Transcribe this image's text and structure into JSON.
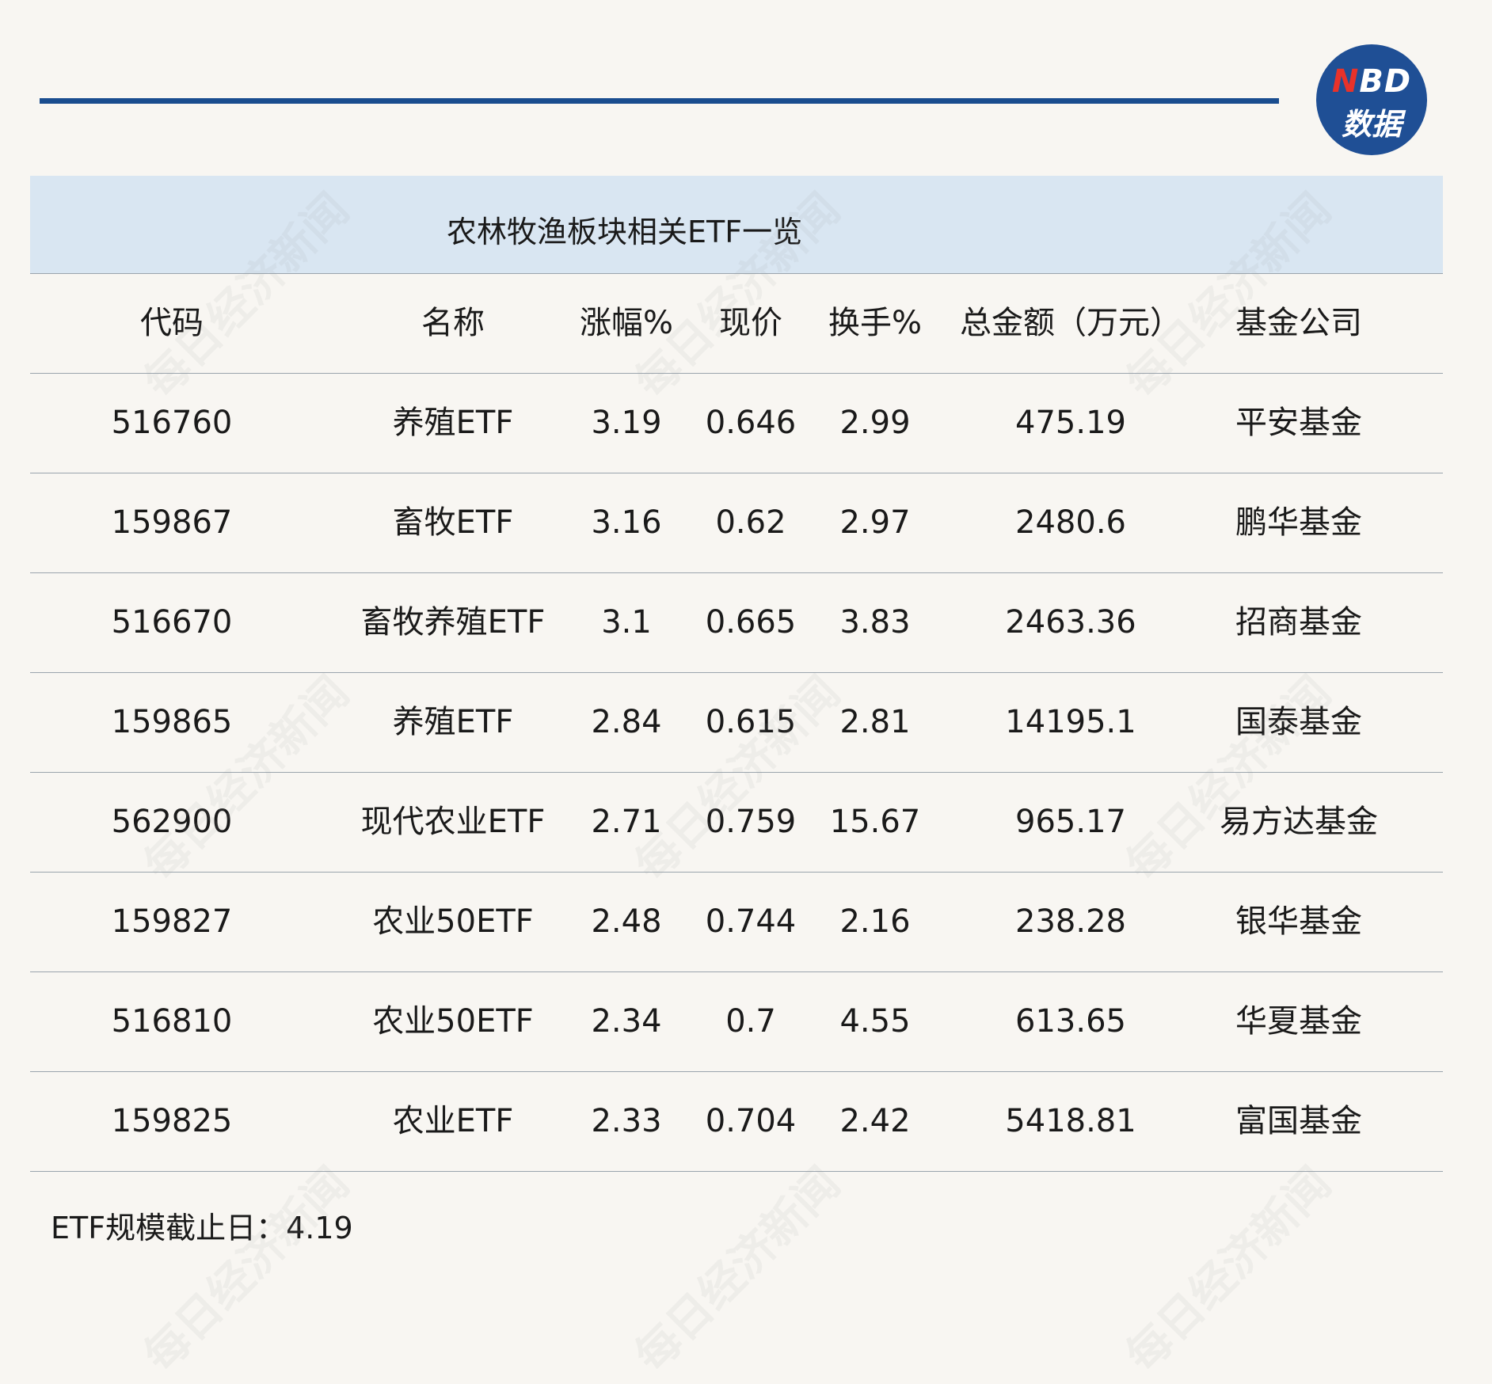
{
  "logo": {
    "line1_n": "N",
    "line1_rest": "BD",
    "line2": "数据"
  },
  "watermark_text": "每日经济新闻",
  "chart_data": {
    "type": "table",
    "title": "农林牧渔板块相关ETF一览",
    "columns": [
      "代码",
      "名称",
      "涨幅%",
      "现价",
      "换手%",
      "总金额（万元）",
      "基金公司"
    ],
    "rows": [
      [
        "516760",
        "养殖ETF",
        "3.19",
        "0.646",
        "2.99",
        "475.19",
        "平安基金"
      ],
      [
        "159867",
        "畜牧ETF",
        "3.16",
        "0.62",
        "2.97",
        "2480.6",
        "鹏华基金"
      ],
      [
        "516670",
        "畜牧养殖ETF",
        "3.1",
        "0.665",
        "3.83",
        "2463.36",
        "招商基金"
      ],
      [
        "159865",
        "养殖ETF",
        "2.84",
        "0.615",
        "2.81",
        "14195.1",
        "国泰基金"
      ],
      [
        "562900",
        "现代农业ETF",
        "2.71",
        "0.759",
        "15.67",
        "965.17",
        "易方达基金"
      ],
      [
        "159827",
        "农业50ETF",
        "2.48",
        "0.744",
        "2.16",
        "238.28",
        "银华基金"
      ],
      [
        "516810",
        "农业50ETF",
        "2.34",
        "0.7",
        "4.55",
        "613.65",
        "华夏基金"
      ],
      [
        "159825",
        "农业ETF",
        "2.33",
        "0.704",
        "2.42",
        "5418.81",
        "富国基金"
      ]
    ],
    "footnote": "ETF规模截止日：4.19"
  }
}
